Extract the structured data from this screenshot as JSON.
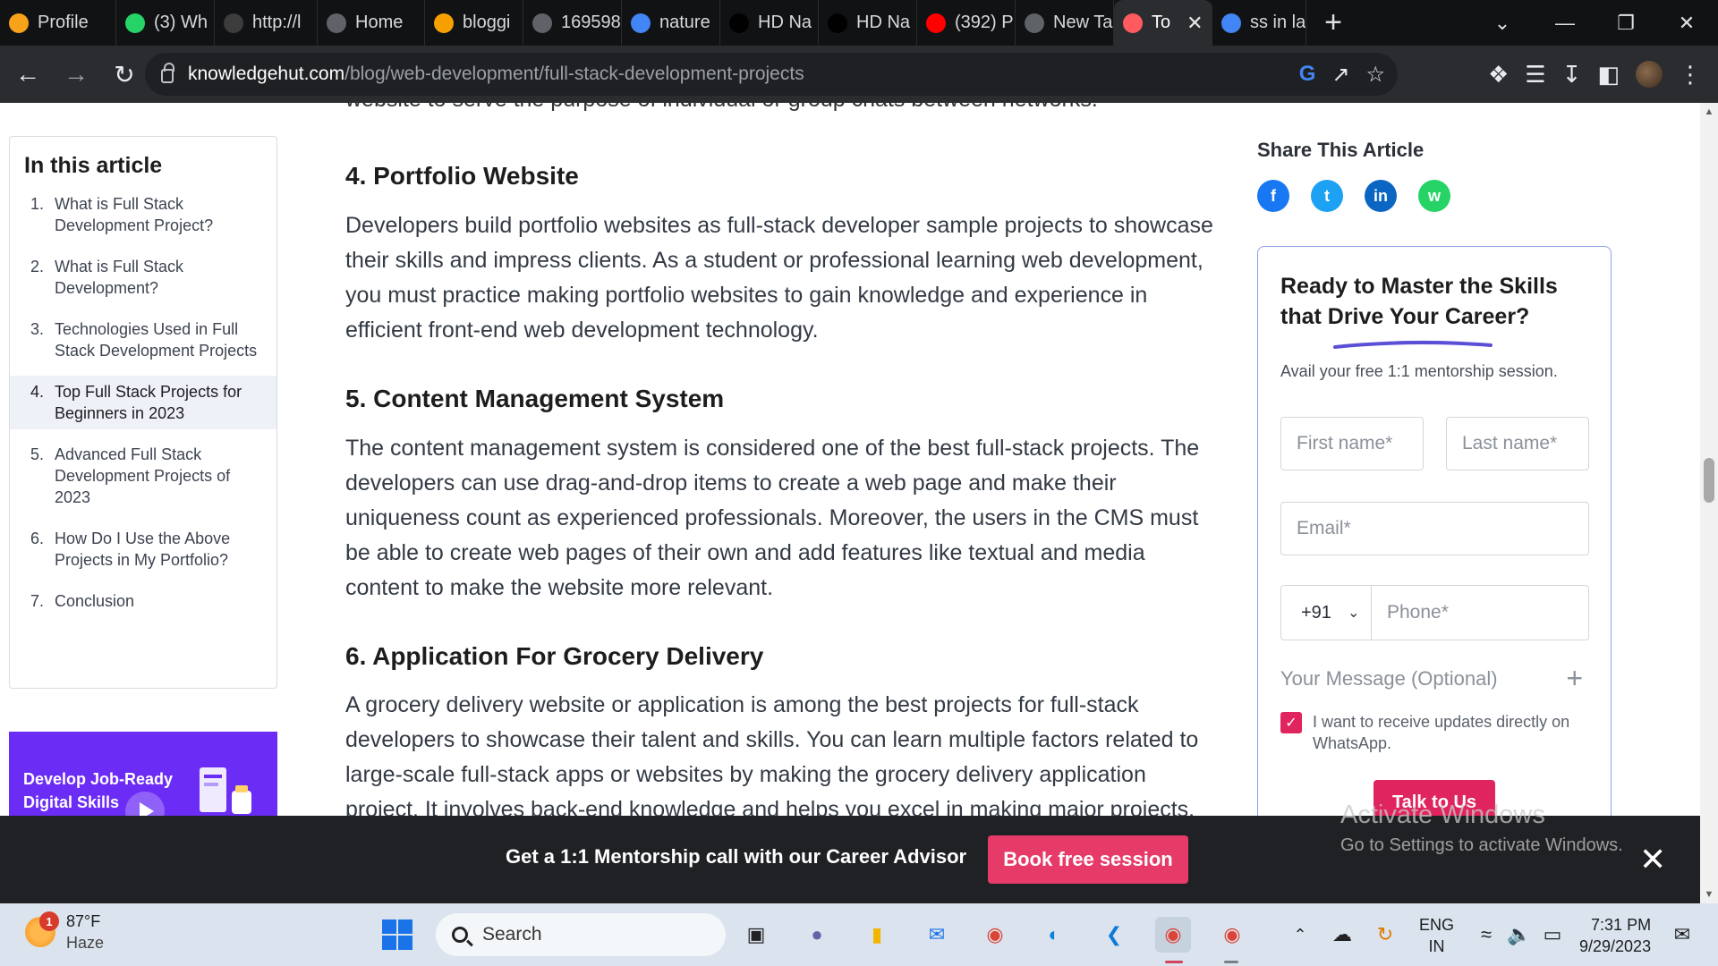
{
  "tabs": [
    {
      "label": "Profile",
      "icon": "profile-icon",
      "color": "#f7a21b"
    },
    {
      "label": "(3) Wh",
      "icon": "whatsapp-icon",
      "color": "#25d366"
    },
    {
      "label": "http://l",
      "icon": "terminal-icon",
      "color": "#3c3c3c"
    },
    {
      "label": "Home",
      "icon": "globe-icon",
      "color": "#5f6368"
    },
    {
      "label": "bloggi",
      "icon": "blogger-icon",
      "color": "#f6a000"
    },
    {
      "label": "169598",
      "icon": "globe-icon",
      "color": "#5f6368"
    },
    {
      "label": "nature",
      "icon": "google-icon",
      "color": "#4285f4"
    },
    {
      "label": "HD Na",
      "icon": "tiktok-icon",
      "color": "#010101"
    },
    {
      "label": "HD Na",
      "icon": "tiktok-icon",
      "color": "#010101"
    },
    {
      "label": "(392) P",
      "icon": "youtube-icon",
      "color": "#ff0000"
    },
    {
      "label": "New Ta",
      "icon": "chrome-icon",
      "color": "#5f6368"
    },
    {
      "label": "To",
      "icon": "knowledgehut-icon",
      "color": "#ff5a5f",
      "active": true
    },
    {
      "label": "ss in la",
      "icon": "google-icon",
      "color": "#4285f4"
    }
  ],
  "address": {
    "host": "knowledgehut.com",
    "path": "/blog/web-development/full-stack-development-projects"
  },
  "toc": {
    "title": "In this article",
    "items": [
      {
        "num": "1.",
        "label": "What is Full Stack Development Project?"
      },
      {
        "num": "2.",
        "label": "What is Full Stack Development?"
      },
      {
        "num": "3.",
        "label": "Technologies Used in Full Stack Development Projects"
      },
      {
        "num": "4.",
        "label": "Top Full Stack Projects for Beginners in 2023",
        "active": true
      },
      {
        "num": "5.",
        "label": "Advanced Full Stack Development Projects of 2023"
      },
      {
        "num": "6.",
        "label": "How Do I Use the Above Projects in My Portfolio?"
      },
      {
        "num": "7.",
        "label": "Conclusion"
      }
    ]
  },
  "promo": {
    "line1": "Develop Job-Ready",
    "line2": "Digital Skills"
  },
  "article": {
    "cut_top": "website to serve the purpose of individual or group chats between networks.",
    "sections": [
      {
        "heading": "4. Portfolio Website",
        "body": "Developers build portfolio websites as full-stack developer sample projects to showcase their skills and impress clients. As a student or professional learning web development, you must practice making portfolio websites to gain knowledge and experience in efficient front-end web development technology."
      },
      {
        "heading": "5. Content Management System",
        "body": "The content management system is considered one of the best full-stack projects. The developers can use drag-and-drop items to create a web page and make their uniqueness count as experienced professionals. Moreover, the users in the CMS must be able to create web pages of their own and add features like textual and media content to make the website more relevant."
      },
      {
        "heading": "6. Application For Grocery Delivery",
        "body": "A grocery delivery website or application is among the best projects for full-stack developers to showcase their talent and skills. You can learn multiple factors related to large-scale full-stack apps or websites by making the grocery delivery application project. It involves back-end knowledge and helps you excel in making major projects."
      }
    ]
  },
  "share": {
    "title": "Share This Article",
    "networks": [
      {
        "name": "facebook-icon",
        "glyph": "f",
        "color": "#1877f2"
      },
      {
        "name": "twitter-icon",
        "glyph": "t",
        "color": "#1da1f2"
      },
      {
        "name": "linkedin-icon",
        "glyph": "in",
        "color": "#0a66c2"
      },
      {
        "name": "whatsapp-icon",
        "glyph": "w",
        "color": "#25d366"
      }
    ]
  },
  "form": {
    "title": "Ready to Master the Skills that Drive Your Career?",
    "subtitle": "Avail your free 1:1 mentorship session.",
    "first_name": "First name*",
    "last_name": "Last name*",
    "email": "Email*",
    "country_code": "+91",
    "phone": "Phone*",
    "message": "Your Message (Optional)",
    "checkbox_label": "I want to receive updates directly on WhatsApp.",
    "checkbox_checked": true,
    "submit": "Talk to Us",
    "accent": "#e0245e"
  },
  "banner": {
    "text": "Get a 1:1 Mentorship call with our Career Advisor",
    "button": "Book free session"
  },
  "watermark": {
    "line1": "Activate Windows",
    "line2": "Go to Settings to activate Windows."
  },
  "taskbar": {
    "weather_temp": "87°F",
    "weather_desc": "Haze",
    "weather_badge": "1",
    "search": "Search",
    "lang1": "ENG",
    "lang2": "IN",
    "time": "7:31 PM",
    "date": "9/29/2023"
  }
}
